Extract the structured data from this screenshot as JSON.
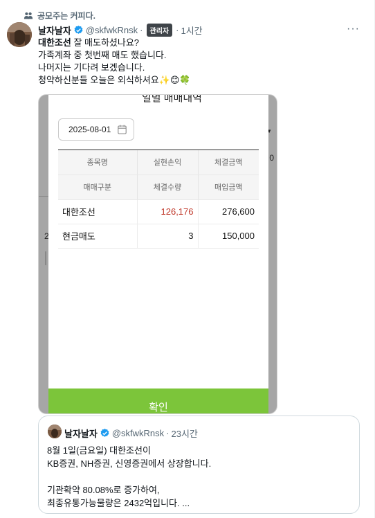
{
  "social_context": {
    "text": "공모주는 커피다.",
    "icon": "people-icon"
  },
  "tweet": {
    "author_name": "날자날자",
    "handle": "@skfwkRnsk",
    "separator": "·",
    "badge": "관리자",
    "time": "1시간",
    "more_label": "···",
    "text_line1_bold": "대한조선",
    "text_line1_rest": " 잘 매도하셨나요?",
    "text_line2": "가족계좌 중 첫번째 매도 했습니다.",
    "text_line3": "나머지는 기다려 보겠습니다.",
    "text_line4": "청약하신분들 오늘은 외식하셔요✨😊🍀",
    "verified_color": "#1d9bf0"
  },
  "media": {
    "bg_title": "일별 매매내역",
    "bg_mark1": "▼",
    "bg_mark2": "0",
    "bg_mark3": "2",
    "date_value": "2025-08-01",
    "table": {
      "header_row1": [
        "종목명",
        "실현손익",
        "체결금액"
      ],
      "header_row2": [
        "매매구분",
        "체결수량",
        "매입금액"
      ],
      "rows": [
        {
          "c1": "대한조선",
          "c2": "126,176",
          "c3": "276,600"
        },
        {
          "c1": "현금매도",
          "c2": "3",
          "c3": "150,000"
        }
      ]
    },
    "confirm_label": "확인",
    "accent_color": "#7cc53a",
    "profit_color": "#c0392b"
  },
  "quote": {
    "author_name": "날자날자",
    "handle": "@skfwkRnsk",
    "separator": "·",
    "time": "23시간",
    "line1": "8월 1일(금요일) 대한조선이",
    "line2": "KB증권, NH증권, 신영증권에서 상장합니다.",
    "line3": "",
    "line4": "기관확약 80.08%로  증가하여,",
    "line5": "최종유통가능물량은 2432억입니다. ..."
  }
}
